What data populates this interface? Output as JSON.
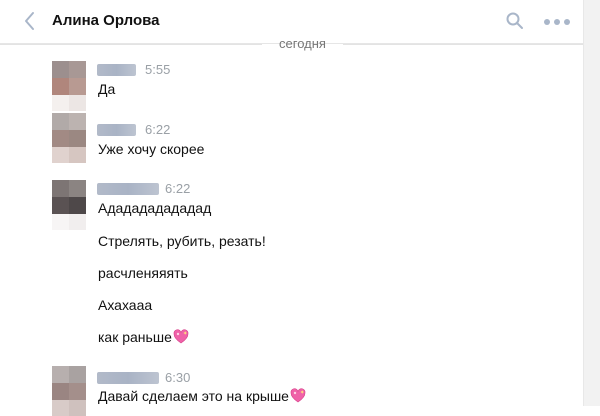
{
  "header": {
    "title": "Алина Орлова"
  },
  "date_separator": "сегодня",
  "messages": [
    {
      "time": "5:55",
      "lines": [
        "Да"
      ]
    },
    {
      "time": "6:22",
      "lines": [
        "Уже хочу скорее"
      ]
    },
    {
      "time": "6:22",
      "lines": [
        "Ададададададад",
        "Стрелять, рубить, резать!",
        "расчленяяять",
        "Ахахааа",
        "как раньше"
      ]
    },
    {
      "time": "6:30",
      "lines": [
        "Давай сделаем это на крыше"
      ]
    }
  ],
  "icons": {
    "back": "chevron-left-icon",
    "search": "search-icon",
    "more": "more-dots-icon",
    "emoji": "sparkling-heart-icon"
  },
  "colors": {
    "accent_icon": "#a9b6c9",
    "time": "#9aa0a6",
    "separator": "#e3e3e3"
  }
}
